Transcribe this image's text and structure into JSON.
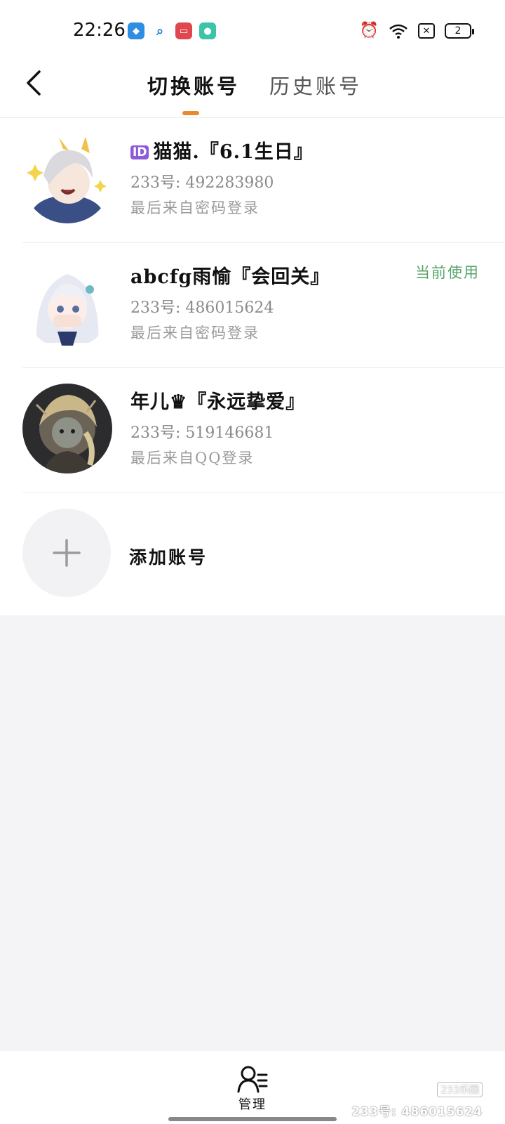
{
  "status_bar": {
    "time": "22:26",
    "battery": "2",
    "apps": [
      "maps-icon",
      "search-icon",
      "video-icon",
      "message-icon"
    ]
  },
  "header": {
    "tab_switch": "切换账号",
    "tab_history": "历史账号",
    "accent_color": "#e88b2e"
  },
  "accounts": [
    {
      "badge": "ID",
      "name": "猫猫.『6.1生日』",
      "id_text": "233号: 492283980",
      "login": "最后来自密码登录",
      "current": ""
    },
    {
      "name": "abcfg雨愉『会回关』",
      "id_text": "233号: 486015624",
      "login": "最后来自密码登录",
      "current": "当前使用"
    },
    {
      "name": "年儿♛『永远挚爱』",
      "id_text": "233号: 519146681",
      "login": "最后来自QQ登录",
      "current": ""
    }
  ],
  "add_account": {
    "label": "添加账号"
  },
  "bottom": {
    "manage_label": "管理",
    "watermark_logo": "233乐园",
    "watermark": "233号: 486015624"
  }
}
